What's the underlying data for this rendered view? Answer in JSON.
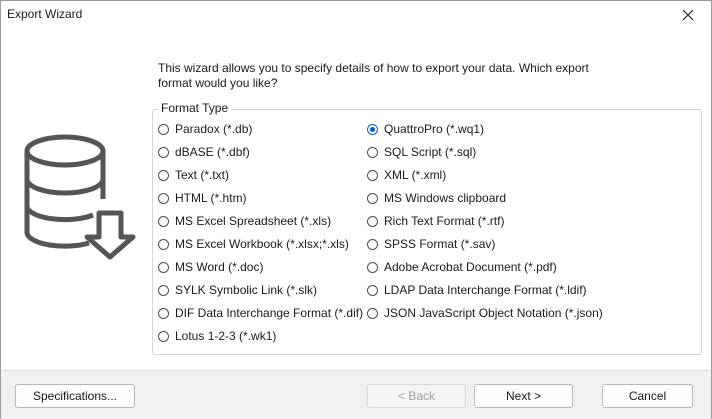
{
  "window": {
    "title": "Export Wizard",
    "close_icon": "close-icon"
  },
  "intro_text": "This wizard allows you to specify details of how to export your data. Which export format would you like?",
  "illustration_icon": "database-export-icon",
  "format_group": {
    "legend": "Format Type",
    "selected": "QuattroPro (*.wq1)",
    "left_options": [
      "Paradox (*.db)",
      "dBASE (*.dbf)",
      "Text (*.txt)",
      "HTML (*.htm)",
      "MS Excel Spreadsheet (*.xls)",
      "MS Excel Workbook (*.xlsx;*.xls)",
      "MS Word (*.doc)",
      "SYLK Symbolic Link (*.slk)",
      "DIF Data Interchange Format (*.dif)",
      "Lotus 1-2-3 (*.wk1)"
    ],
    "right_options": [
      "QuattroPro (*.wq1)",
      "SQL Script (*.sql)",
      "XML (*.xml)",
      "MS Windows clipboard",
      "Rich Text Format (*.rtf)",
      "SPSS Format (*.sav)",
      "Adobe Acrobat Document (*.pdf)",
      "LDAP Data Interchange Format (*.ldif)",
      "JSON JavaScript Object Notation (*.json)"
    ]
  },
  "buttons": {
    "specifications": "Specifications...",
    "back": "< Back",
    "back_enabled": false,
    "next": "Next >",
    "cancel": "Cancel"
  },
  "colors": {
    "accent": "#0a5fc2",
    "footer_bg": "#f0f0f0"
  }
}
